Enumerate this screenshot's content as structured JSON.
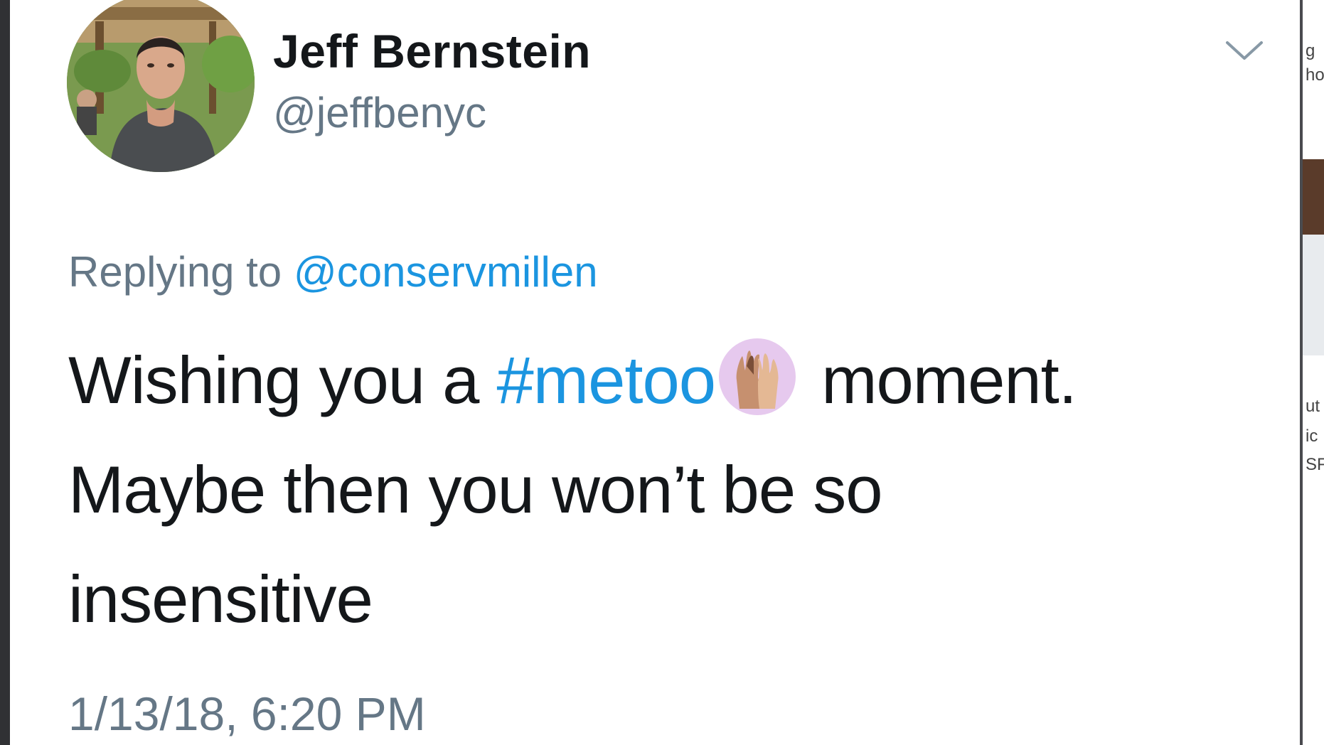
{
  "tweet": {
    "display_name": "Jeff Bernstein",
    "handle": "@jeffbenyc",
    "reply_prefix": "Replying to",
    "reply_mention": "@conservmillen",
    "text_line1_before": "Wishing you a",
    "hashtag": "#metoo",
    "text_line1_after": "moment.",
    "text_line2": "Maybe then you won’t be so",
    "text_line3": "insensitive",
    "timestamp": "1/13/18, 6:20 PM",
    "emoji_name": "raised-hands-emoji"
  },
  "right_fragments": [
    "g",
    "ho",
    "ut",
    "ic",
    "SF"
  ],
  "colors": {
    "link": "#1b95e0",
    "secondary_text": "#657786",
    "primary_text": "#14171a",
    "background": "#ffffff"
  }
}
